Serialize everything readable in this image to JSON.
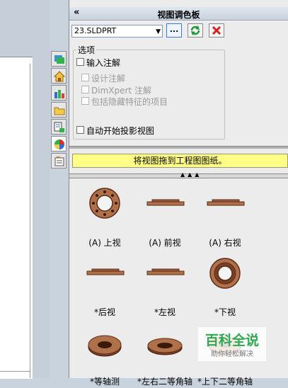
{
  "panel": {
    "title": "视图调色板",
    "collapse_label": "«",
    "file_select_value": "23.SLDPRT",
    "browse_label": "...",
    "options_label": "选项",
    "import_annotations_label": "输入注解",
    "design_annotations_label": "设计注解",
    "dimxpert_annotations_label": "DimXpert 注解",
    "hidden_features_label": "包括隐藏特征的项目",
    "auto_projected_label": "自动开始投影视图",
    "drag_hint": "将视图拖到工程图图纸。"
  },
  "views": [
    {
      "label": "(A) 上视",
      "icon": "flange-top-view"
    },
    {
      "label": "(A) 前视",
      "icon": "flange-front-view"
    },
    {
      "label": "(A) 右视",
      "icon": "flange-right-view"
    },
    {
      "label": "*后视",
      "icon": "flange-back-view"
    },
    {
      "label": "*左视",
      "icon": "flange-left-view"
    },
    {
      "label": "*下视",
      "icon": "flange-bottom-view"
    },
    {
      "label": "*等轴测",
      "icon": "flange-isometric-view"
    },
    {
      "label": "*左右二等角轴",
      "icon": "flange-dimetric-view"
    },
    {
      "label": "*上下二等角轴",
      "icon": "flange-trimetric-view"
    }
  ],
  "watermark": {
    "title": "百科全说",
    "subtitle": "助你轻松解决"
  },
  "colors": {
    "flange": "#b0704a",
    "flange_dark": "#5a2d18",
    "hint_bg": "#ffff88"
  }
}
